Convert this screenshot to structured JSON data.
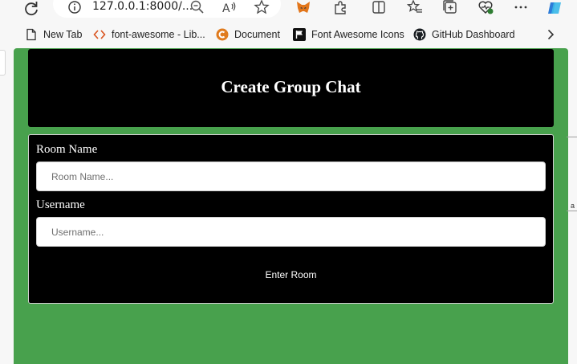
{
  "browser": {
    "url": "127.0.0.1:8000/...",
    "bookmarks": [
      {
        "label": "New Tab",
        "icon": "page-icon"
      },
      {
        "label": "font-awesome - Lib...",
        "icon": "code-icon"
      },
      {
        "label": "Document",
        "icon": "document-favicon"
      },
      {
        "label": "Font Awesome Icons",
        "icon": "flag-icon"
      },
      {
        "label": "GitHub Dashboard",
        "icon": "github-icon"
      }
    ],
    "toolbar_icons": [
      "refresh-icon",
      "info-icon",
      "zoom-icon",
      "read-aloud-icon",
      "favorite-star-icon",
      "metamask-icon",
      "extensions-icon",
      "split-screen-icon",
      "favorites-icon",
      "collections-icon",
      "browser-essentials-icon",
      "more-icon",
      "copilot-icon"
    ],
    "colors": {
      "chrome": "#f7f7f7",
      "text": "#1f1f1f"
    }
  },
  "page": {
    "title": "Create Group Chat",
    "room_name_label": "Room Name",
    "room_name_placeholder": "Room Name...",
    "username_label": "Username",
    "username_placeholder": "Username...",
    "enter_button": "Enter Room",
    "edge_text": "a",
    "colors": {
      "background": "#48a14d",
      "card": "#000000",
      "text": "#ffffff"
    }
  }
}
